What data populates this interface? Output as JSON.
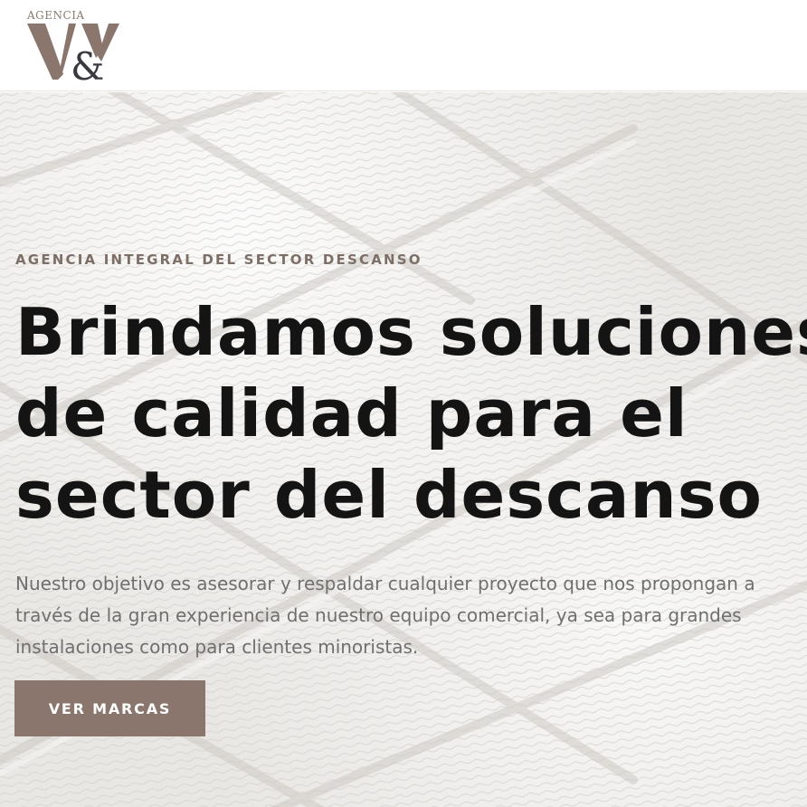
{
  "header": {
    "logo": {
      "agency_text": "AGENCIA",
      "monogram_text": "V&",
      "colors": {
        "v": "#8a766d",
        "ampersand": "#3b3840",
        "agency": "#8a7a70"
      }
    }
  },
  "hero": {
    "eyebrow": "AGENCIA INTEGRAL DEL SECTOR DESCANSO",
    "headline_lines": [
      "Brindamos soluciones",
      "de calidad para el",
      "sector del descanso"
    ],
    "description_lines": [
      "Nuestro objetivo es asesorar y respaldar cualquier proyecto que nos propongan a",
      "través de la gran experiencia de nuestro equipo comercial, ya sea para grandes",
      "instalaciones como para clientes minoristas."
    ],
    "cta_label": "VER MARCAS",
    "background_icon": "quilted-mattress-texture"
  },
  "colors": {
    "accent": "#8a766d",
    "eyebrow": "#7d6e66",
    "headline": "#141414",
    "body_text": "#6f6f6f"
  }
}
